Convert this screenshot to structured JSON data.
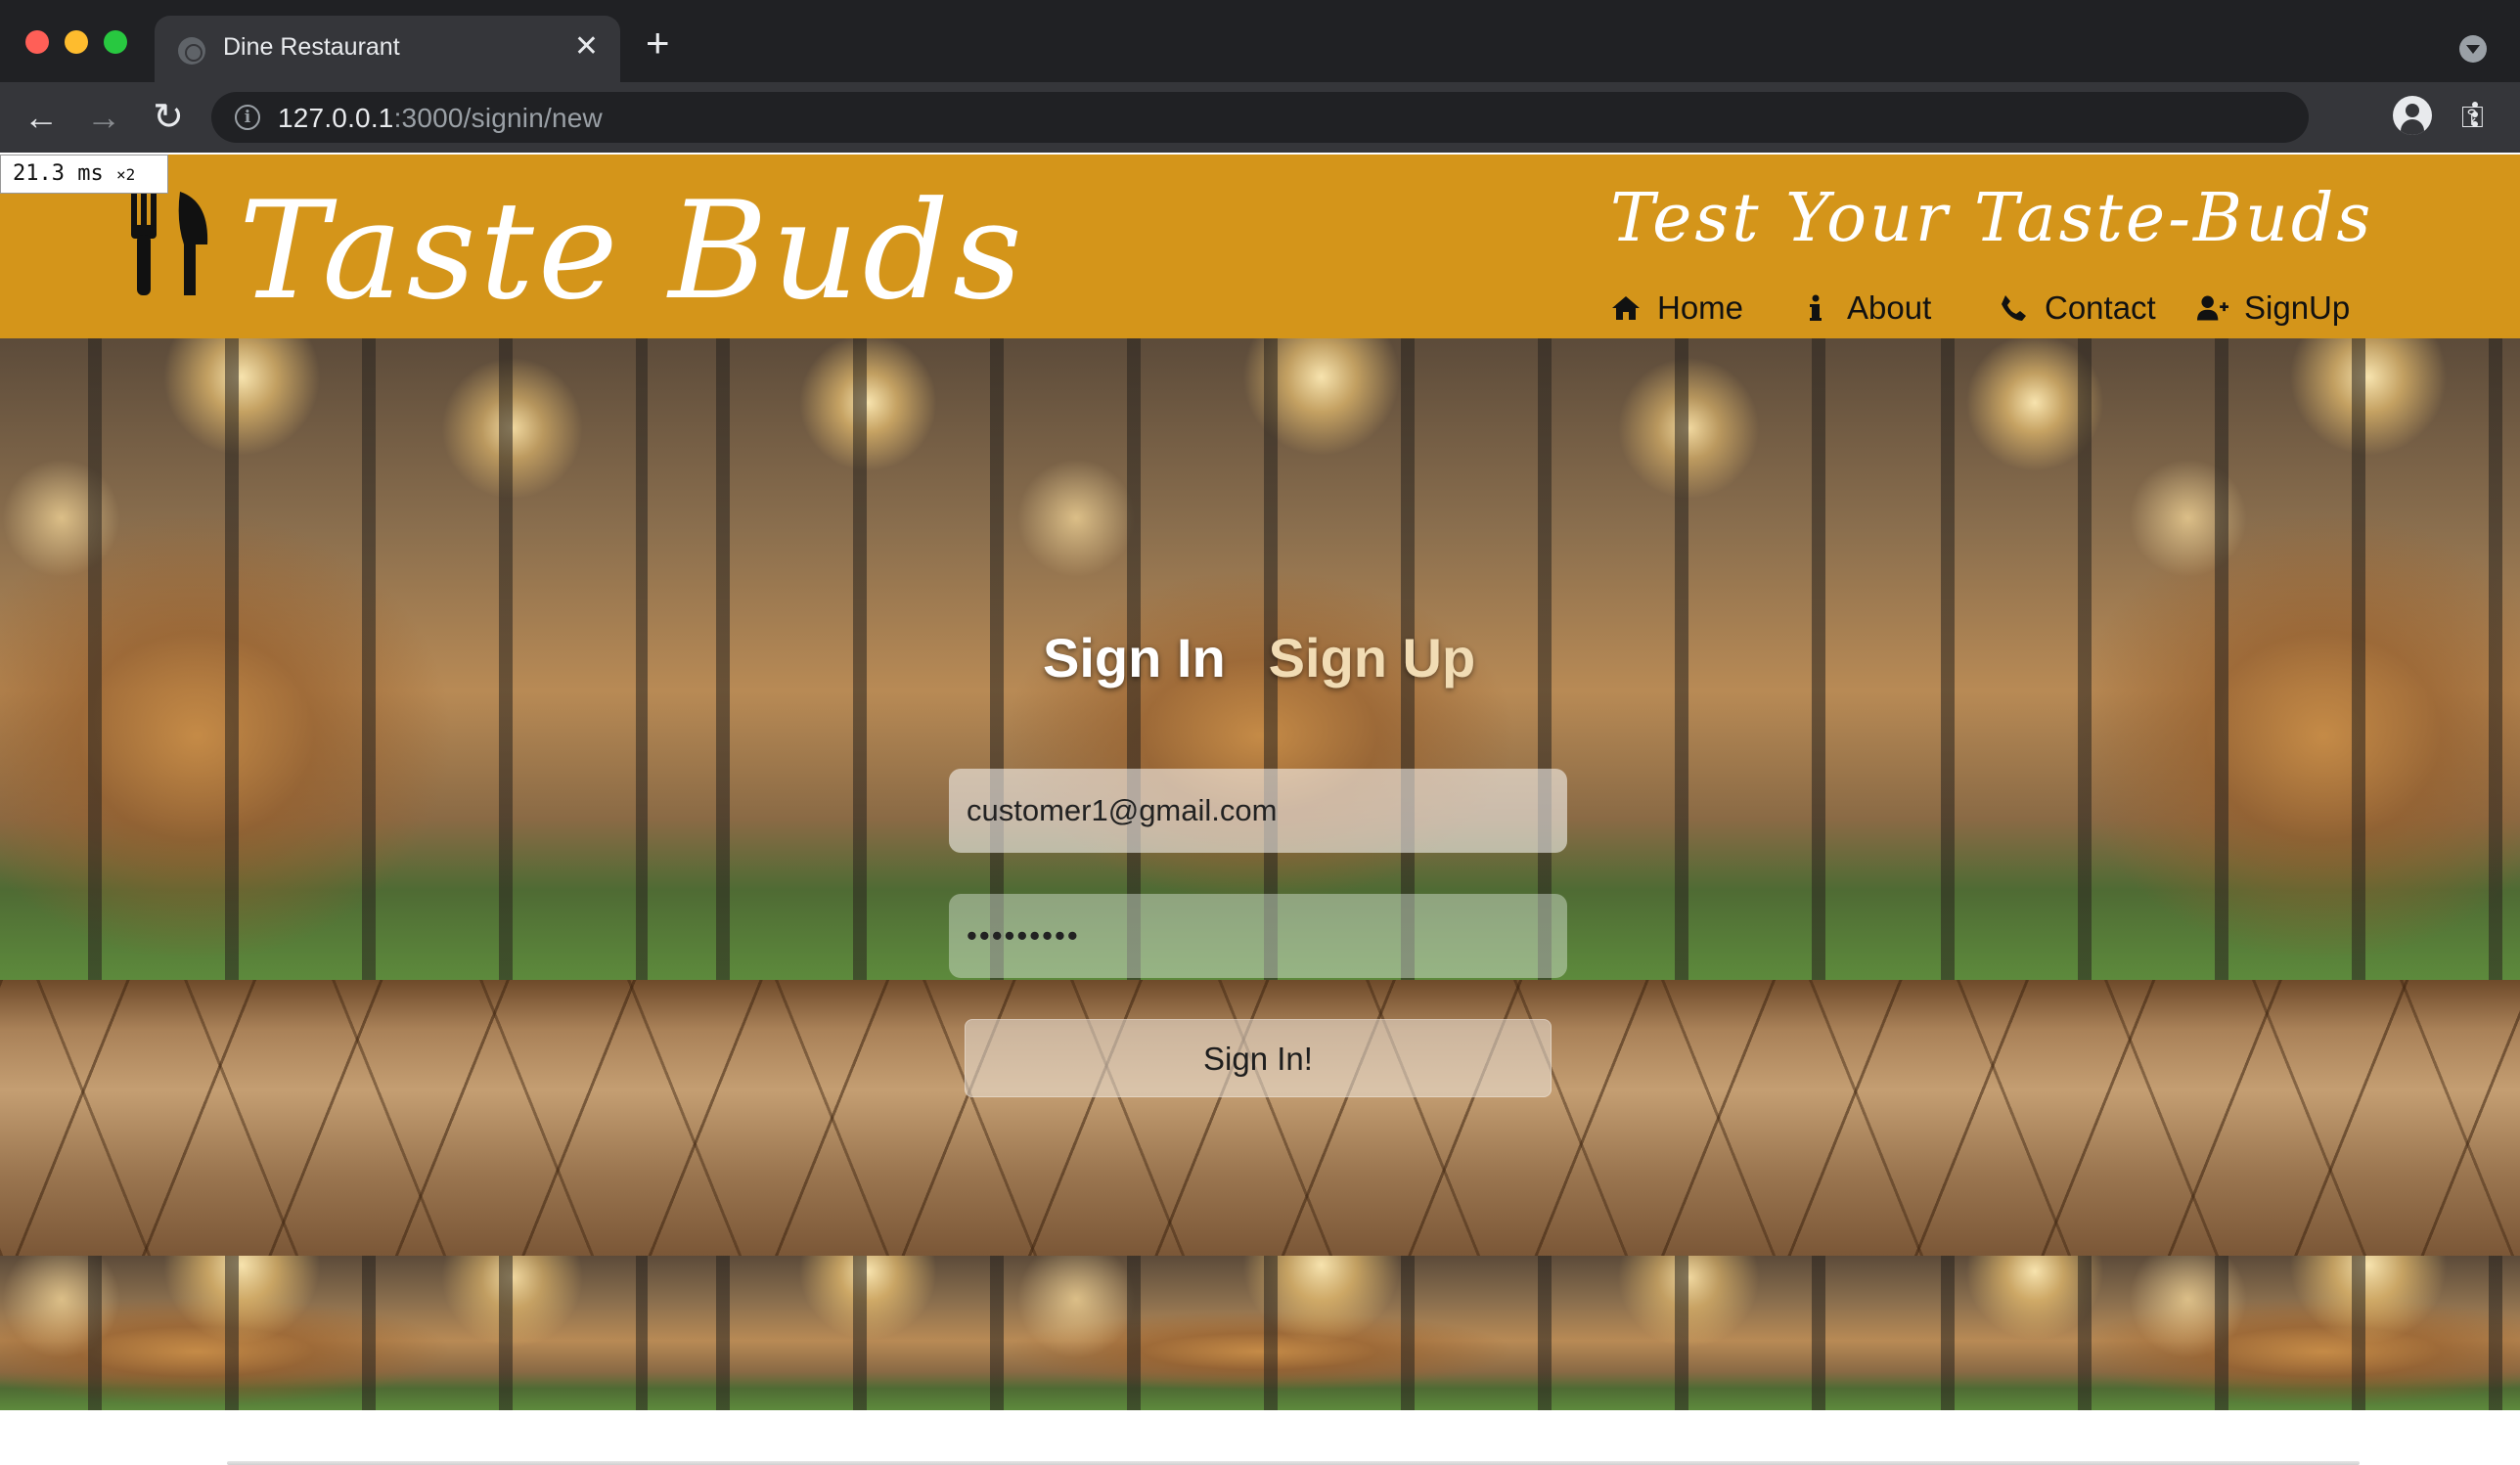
{
  "browser": {
    "tab_title": "Dine Restaurant",
    "tab_close": "✕",
    "new_tab": "+",
    "url_host": "127.0.0.1",
    "url_path": ":3000/signin/new",
    "back": "←",
    "forward": "→",
    "reload": "↻",
    "info": "i",
    "key": "⚿",
    "star": "☆"
  },
  "perf_badge": {
    "value": "21.3 ms",
    "multiplier": "×2"
  },
  "header": {
    "brand": "Taste Buds",
    "tagline": "Test Your Taste-Buds",
    "nav": [
      {
        "label": "Home",
        "icon": "home-icon"
      },
      {
        "label": "About",
        "icon": "info-icon"
      },
      {
        "label": "Contact",
        "icon": "phone-icon"
      },
      {
        "label": "SignUp",
        "icon": "add-user-icon"
      }
    ]
  },
  "form": {
    "tab_signin": "Sign In",
    "tab_signup": "Sign Up",
    "email_value": "customer1@gmail.com",
    "password_value": "•••••••••",
    "submit_label": "Sign In!"
  },
  "colors": {
    "header_bg": "#d4951a",
    "chrome_dark": "#202124",
    "chrome_toolbar": "#35363a"
  }
}
